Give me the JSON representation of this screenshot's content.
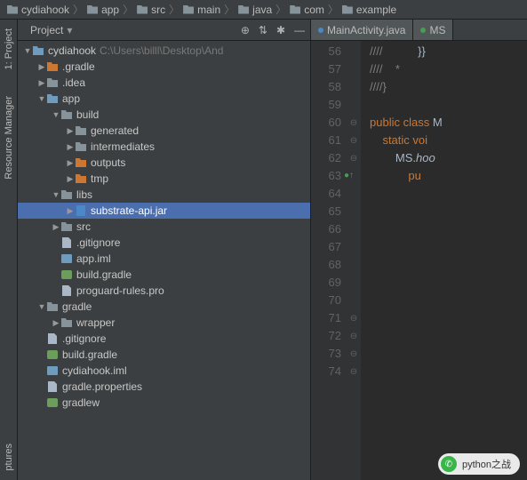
{
  "breadcrumb": [
    "cydiahook",
    "app",
    "src",
    "main",
    "java",
    "com",
    "example"
  ],
  "side_tabs": {
    "project": "1: Project",
    "resmgr": "Resource Manager",
    "structures": "ptures"
  },
  "panel": {
    "title": "Project"
  },
  "tree": [
    {
      "d": 0,
      "a": "down",
      "i": "folder-module",
      "t": "cydiahook",
      "x": "C:\\Users\\billl\\Desktop\\And"
    },
    {
      "d": 1,
      "a": "right",
      "i": "folder-brown",
      "t": ".gradle"
    },
    {
      "d": 1,
      "a": "right",
      "i": "folder-grey",
      "t": ".idea"
    },
    {
      "d": 1,
      "a": "down",
      "i": "folder-module",
      "t": "app"
    },
    {
      "d": 2,
      "a": "down",
      "i": "folder-grey",
      "t": "build"
    },
    {
      "d": 3,
      "a": "right",
      "i": "folder-grey",
      "t": "generated"
    },
    {
      "d": 3,
      "a": "right",
      "i": "folder-grey",
      "t": "intermediates"
    },
    {
      "d": 3,
      "a": "right",
      "i": "folder-brown",
      "t": "outputs"
    },
    {
      "d": 3,
      "a": "right",
      "i": "folder-brown",
      "t": "tmp"
    },
    {
      "d": 2,
      "a": "down",
      "i": "folder-grey",
      "t": "libs"
    },
    {
      "d": 3,
      "a": "right",
      "i": "jar-icon",
      "t": "substrate-api.jar",
      "sel": true
    },
    {
      "d": 2,
      "a": "right",
      "i": "folder-grey",
      "t": "src"
    },
    {
      "d": 2,
      "a": "",
      "i": "file-icon",
      "t": ".gitignore"
    },
    {
      "d": 2,
      "a": "",
      "i": "iml-icon",
      "t": "app.iml"
    },
    {
      "d": 2,
      "a": "",
      "i": "gradle-icon",
      "t": "build.gradle"
    },
    {
      "d": 2,
      "a": "",
      "i": "file-icon",
      "t": "proguard-rules.pro"
    },
    {
      "d": 1,
      "a": "down",
      "i": "folder-grey",
      "t": "gradle"
    },
    {
      "d": 2,
      "a": "right",
      "i": "folder-grey",
      "t": "wrapper"
    },
    {
      "d": 1,
      "a": "",
      "i": "file-icon",
      "t": ".gitignore"
    },
    {
      "d": 1,
      "a": "",
      "i": "gradle-icon",
      "t": "build.gradle"
    },
    {
      "d": 1,
      "a": "",
      "i": "iml-icon",
      "t": "cydiahook.iml"
    },
    {
      "d": 1,
      "a": "",
      "i": "file-icon",
      "t": "gradle.properties"
    },
    {
      "d": 1,
      "a": "",
      "i": "gradle-icon",
      "t": "gradlew"
    }
  ],
  "editor_tabs": [
    {
      "label": "MainActivity.java",
      "cls": "java"
    },
    {
      "label": "MS",
      "cls": ""
    }
  ],
  "gutter": [
    "56",
    "57",
    "58",
    "59",
    "60",
    "61",
    "62",
    "63",
    "64",
    "65",
    "66",
    "67",
    "68",
    "69",
    "70",
    "71",
    "72",
    "73",
    "74"
  ],
  "code": [
    {
      "seg": [
        {
          "c": "c-grey",
          "t": "////"
        },
        {
          "c": "",
          "t": "           }}"
        }
      ]
    },
    {
      "seg": [
        {
          "c": "c-grey",
          "t": "////    *"
        }
      ]
    },
    {
      "seg": [
        {
          "c": "c-grey",
          "t": "////}"
        }
      ]
    },
    {
      "seg": []
    },
    {
      "seg": [
        {
          "c": "c-kw",
          "t": "public class "
        },
        {
          "c": "c-cls",
          "t": "M"
        }
      ]
    },
    {
      "seg": [
        {
          "c": "c-kw",
          "t": "    static voi"
        }
      ]
    },
    {
      "seg": [
        {
          "c": "",
          "t": "        MS."
        },
        {
          "c": "c-italic",
          "t": "hoo"
        }
      ]
    },
    {
      "seg": [
        {
          "c": "c-kw",
          "t": "            pu"
        }
      ]
    },
    {
      "seg": []
    },
    {
      "seg": []
    },
    {
      "seg": []
    },
    {
      "seg": []
    },
    {
      "seg": []
    },
    {
      "seg": []
    },
    {
      "seg": []
    },
    {
      "seg": []
    },
    {
      "seg": []
    },
    {
      "seg": []
    },
    {
      "seg": []
    }
  ],
  "markers": {
    "63": "●↑"
  },
  "fold": [
    "",
    "",
    "",
    "",
    "⊖",
    "⊖",
    "⊖",
    "",
    "",
    "",
    "",
    "",
    "",
    "",
    "",
    "⊖",
    "⊖",
    "⊖",
    "⊖"
  ],
  "watermark": "python之战"
}
